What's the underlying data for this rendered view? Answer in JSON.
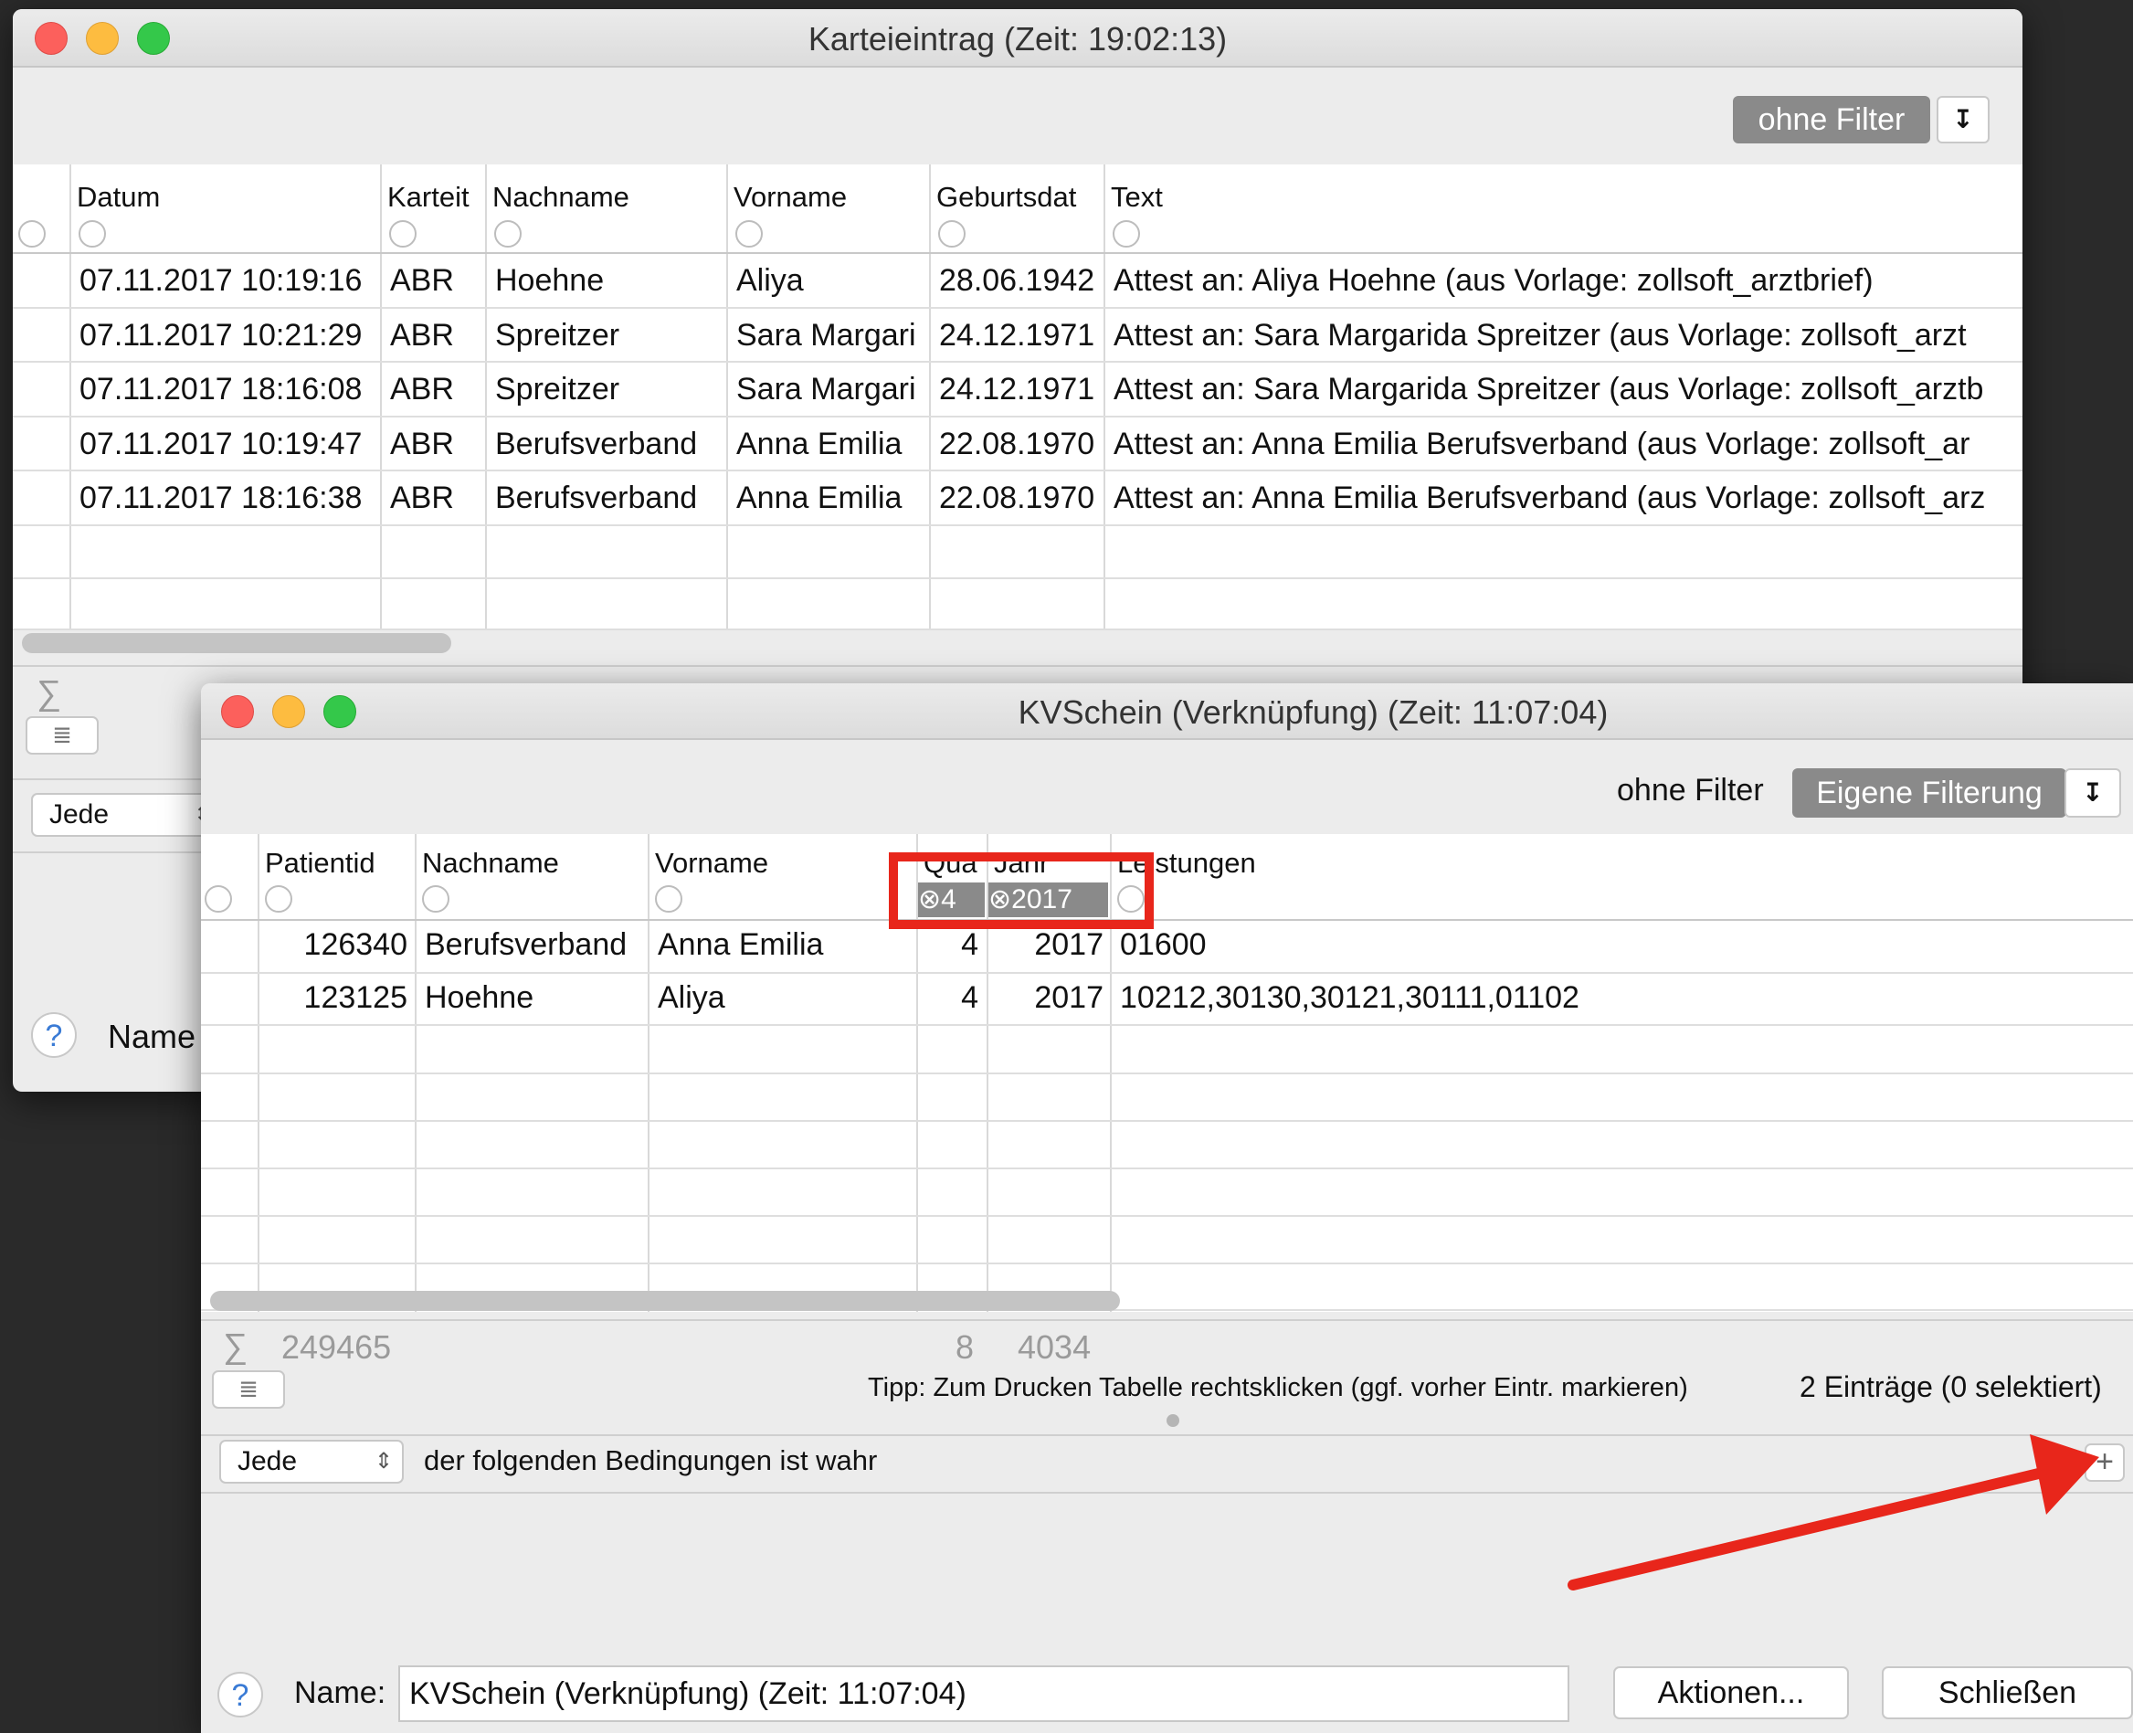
{
  "back_window": {
    "title": "Karteieintrag  (Zeit: 19:02:13)",
    "filter_label": "ohne Filter",
    "columns": [
      "Datum",
      "Karteit",
      "Nachname",
      "Vorname",
      "Geburtsdat",
      "Text"
    ],
    "rows": [
      [
        "07.11.2017 10:19:16",
        "ABR",
        "Hoehne",
        "Aliya",
        "28.06.1942",
        "Attest an: Aliya Hoehne (aus Vorlage: zollsoft_arztbrief)"
      ],
      [
        "07.11.2017 10:21:29",
        "ABR",
        "Spreitzer",
        "Sara Margari",
        "24.12.1971",
        "Attest  an: Sara Margarida Spreitzer (aus Vorlage: zollsoft_arzt"
      ],
      [
        "07.11.2017 18:16:08",
        "ABR",
        "Spreitzer",
        "Sara Margari",
        "24.12.1971",
        "Attest an: Sara Margarida Spreitzer (aus Vorlage: zollsoft_arztb"
      ],
      [
        "07.11.2017 10:19:47",
        "ABR",
        "Berufsverband",
        "Anna Emilia",
        "22.08.1970",
        "Attest  an: Anna Emilia Berufsverband (aus Vorlage: zollsoft_ar"
      ],
      [
        "07.11.2017 18:16:38",
        "ABR",
        "Berufsverband",
        "Anna Emilia",
        "22.08.1970",
        "Attest an: Anna Emilia Berufsverband (aus Vorlage: zollsoft_arz"
      ]
    ],
    "sum_symbol": "∑",
    "condition_popup": "Jede",
    "name_label": "Name"
  },
  "front_window": {
    "title": "KVSchein (Verknüpfung) (Zeit: 11:07:04)",
    "filter_text": "ohne Filter",
    "filter_button": "Eigene Filterung",
    "columns": [
      "Patientid",
      "Nachname",
      "Vorname",
      "Qua",
      "Jahr",
      "Leistungen"
    ],
    "filter_chips": {
      "quarter": "4",
      "year": "2017"
    },
    "rows": [
      [
        "126340",
        "Berufsverband",
        "Anna Emilia",
        "4",
        "2017",
        "01600"
      ],
      [
        "123125",
        "Hoehne",
        "Aliya",
        "4",
        "2017",
        "10212,30130,30121,30111,01102"
      ]
    ],
    "sums": {
      "patientid": "249465",
      "quarter": "8",
      "year": "4034"
    },
    "sum_symbol": "∑",
    "tip": "Tipp: Zum Drucken Tabelle rechtsklicken (ggf. vorher Eintr. markieren)",
    "count_label": "2 Einträge (0 selektiert)",
    "condition_popup": "Jede",
    "condition_text": "der folgenden Bedingungen ist wahr",
    "add_symbol": "+",
    "name_label": "Name:",
    "name_value": "KVSchein (Verknüpfung) (Zeit: 11:07:04)",
    "actions_button": "Aktionen...",
    "close_button": "Schließen",
    "help_symbol": "?"
  },
  "annotation_colors": {
    "highlight": "#e8261b",
    "arrow": "#e8261b"
  }
}
